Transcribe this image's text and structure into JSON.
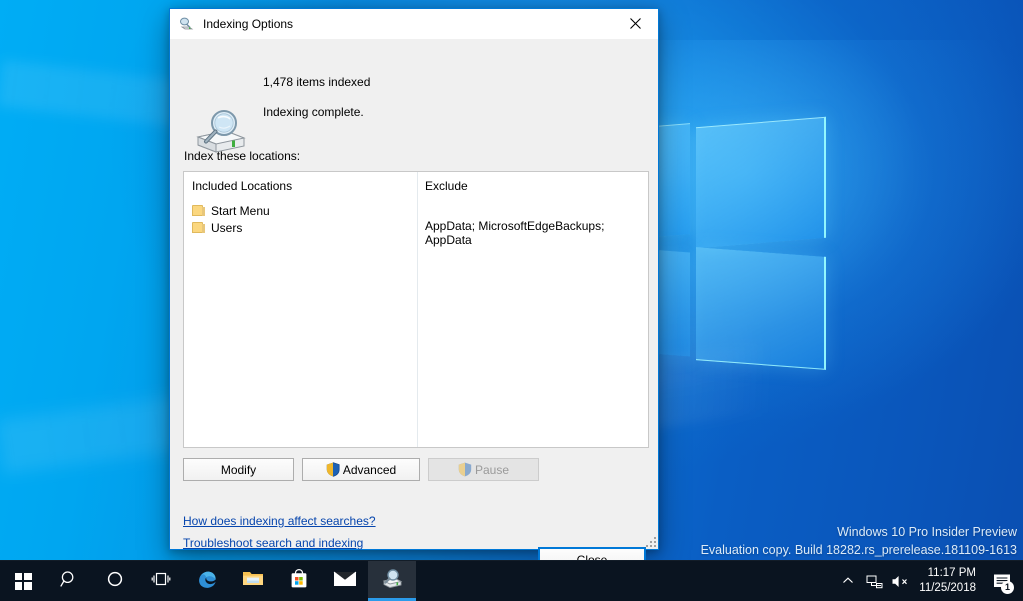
{
  "desktop": {
    "watermark_line1": "Windows 10 Pro Insider Preview",
    "watermark_line2": "Evaluation copy. Build 18282.rs_prerelease.181109-1613",
    "wallpaper_colors": {
      "left": "#00adf5",
      "right": "#0a4fb2",
      "accent": "#2b9bea"
    }
  },
  "dialog": {
    "title": "Indexing Options",
    "title_icon": "indexing-options-icon",
    "close_icon": "close-icon",
    "status": {
      "icon": "magnifier-over-drive-icon",
      "items_indexed": "1,478 items indexed",
      "state": "Indexing complete."
    },
    "locations_label": "Index these locations:",
    "list": {
      "columns": [
        "Included Locations",
        "Exclude"
      ],
      "rows": [
        {
          "icon": "folder-icon",
          "name": "Start Menu",
          "exclude": ""
        },
        {
          "icon": "folder-icon",
          "name": "Users",
          "exclude": "AppData; MicrosoftEdgeBackups; AppData"
        }
      ]
    },
    "buttons": {
      "modify": "Modify",
      "advanced": "Advanced",
      "advanced_icon": "uac-shield-icon",
      "pause": "Pause",
      "pause_icon": "uac-shield-icon",
      "pause_disabled": true,
      "close": "Close"
    },
    "links": [
      "How does indexing affect searches?",
      "Troubleshoot search and indexing"
    ]
  },
  "taskbar": {
    "buttons": [
      {
        "name": "start-button",
        "icon": "windows-logo-icon"
      },
      {
        "name": "search-button",
        "icon": "search-icon"
      },
      {
        "name": "cortana-button",
        "icon": "cortana-circle-icon"
      },
      {
        "name": "task-view-button",
        "icon": "task-view-icon"
      },
      {
        "name": "edge-button",
        "icon": "edge-icon"
      },
      {
        "name": "file-explorer-button",
        "icon": "folder-icon"
      },
      {
        "name": "microsoft-store-button",
        "icon": "store-bag-icon"
      },
      {
        "name": "mail-button",
        "icon": "envelope-icon"
      },
      {
        "name": "indexing-options-taskbar-button",
        "icon": "indexing-options-icon"
      }
    ],
    "tray": {
      "chevron": "show-hidden-icons",
      "network": "network-icon",
      "volume": "volume-muted-icon",
      "time": "11:17 PM",
      "date": "11/25/2018",
      "action_center_badge": "1"
    }
  }
}
